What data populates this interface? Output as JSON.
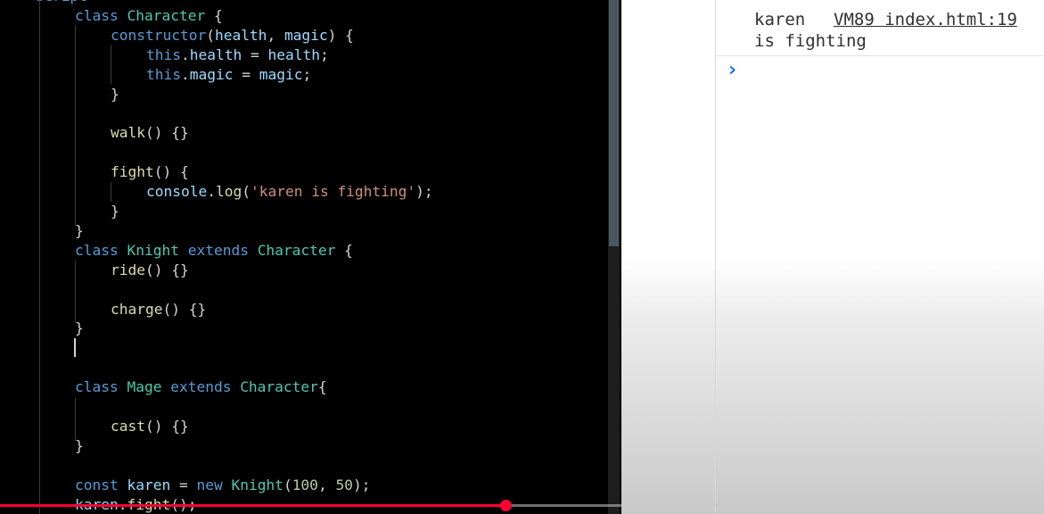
{
  "editor": {
    "partial_top_line": "script",
    "lines": [
      {
        "tokens": [
          {
            "t": "class ",
            "c": "kw"
          },
          {
            "t": "Character",
            "c": "cls"
          },
          {
            "t": " {",
            "c": "def"
          }
        ]
      },
      {
        "tokens": [
          {
            "t": "constructor",
            "c": "kw"
          },
          {
            "t": "(",
            "c": "def"
          },
          {
            "t": "health",
            "c": "par"
          },
          {
            "t": ", ",
            "c": "def"
          },
          {
            "t": "magic",
            "c": "par"
          },
          {
            "t": ") {",
            "c": "def"
          }
        ]
      },
      {
        "tokens": [
          {
            "t": "this",
            "c": "kw"
          },
          {
            "t": ".",
            "c": "def"
          },
          {
            "t": "health",
            "c": "par"
          },
          {
            "t": " = ",
            "c": "def"
          },
          {
            "t": "health",
            "c": "par"
          },
          {
            "t": ";",
            "c": "def"
          }
        ]
      },
      {
        "tokens": [
          {
            "t": "this",
            "c": "kw"
          },
          {
            "t": ".",
            "c": "def"
          },
          {
            "t": "magic",
            "c": "par"
          },
          {
            "t": " = ",
            "c": "def"
          },
          {
            "t": "magic",
            "c": "par"
          },
          {
            "t": ";",
            "c": "def"
          }
        ]
      },
      {
        "tokens": [
          {
            "t": "}",
            "c": "def"
          }
        ]
      },
      {
        "tokens": []
      },
      {
        "tokens": [
          {
            "t": "walk",
            "c": "fn"
          },
          {
            "t": "() {}",
            "c": "def"
          }
        ]
      },
      {
        "tokens": []
      },
      {
        "tokens": [
          {
            "t": "fight",
            "c": "fn"
          },
          {
            "t": "() {",
            "c": "def"
          }
        ]
      },
      {
        "tokens": [
          {
            "t": "console",
            "c": "par"
          },
          {
            "t": ".",
            "c": "def"
          },
          {
            "t": "log",
            "c": "fn"
          },
          {
            "t": "(",
            "c": "def"
          },
          {
            "t": "'karen is fighting'",
            "c": "str"
          },
          {
            "t": ");",
            "c": "def"
          }
        ]
      },
      {
        "tokens": [
          {
            "t": "}",
            "c": "def"
          }
        ]
      },
      {
        "tokens": [
          {
            "t": "}",
            "c": "def"
          }
        ]
      },
      {
        "tokens": [
          {
            "t": "class ",
            "c": "kw"
          },
          {
            "t": "Knight",
            "c": "cls"
          },
          {
            "t": " extends ",
            "c": "kw"
          },
          {
            "t": "Character",
            "c": "cls"
          },
          {
            "t": " {",
            "c": "def"
          }
        ]
      },
      {
        "tokens": [
          {
            "t": "ride",
            "c": "fn"
          },
          {
            "t": "() {}",
            "c": "def"
          }
        ]
      },
      {
        "tokens": []
      },
      {
        "tokens": [
          {
            "t": "charge",
            "c": "fn"
          },
          {
            "t": "() {}",
            "c": "def"
          }
        ]
      },
      {
        "tokens": [
          {
            "t": "}",
            "c": "def"
          }
        ]
      },
      {
        "tokens": []
      },
      {
        "tokens": []
      },
      {
        "tokens": [
          {
            "t": "class ",
            "c": "kw"
          },
          {
            "t": "Mage",
            "c": "cls"
          },
          {
            "t": " extends ",
            "c": "kw"
          },
          {
            "t": "Character",
            "c": "cls"
          },
          {
            "t": "{",
            "c": "def"
          }
        ]
      },
      {
        "tokens": []
      },
      {
        "tokens": [
          {
            "t": "cast",
            "c": "fn"
          },
          {
            "t": "() {}",
            "c": "def"
          }
        ]
      },
      {
        "tokens": [
          {
            "t": "}",
            "c": "def"
          }
        ]
      },
      {
        "tokens": []
      },
      {
        "tokens": [
          {
            "t": "const ",
            "c": "kw"
          },
          {
            "t": "karen",
            "c": "par"
          },
          {
            "t": " = ",
            "c": "def"
          },
          {
            "t": "new ",
            "c": "kw"
          },
          {
            "t": "Knight",
            "c": "cls"
          },
          {
            "t": "(",
            "c": "def"
          },
          {
            "t": "100",
            "c": "num"
          },
          {
            "t": ", ",
            "c": "def"
          },
          {
            "t": "50",
            "c": "num"
          },
          {
            "t": ");",
            "c": "def"
          }
        ]
      },
      {
        "tokens": [
          {
            "t": "karen",
            "c": "par"
          },
          {
            "t": ".",
            "c": "def"
          },
          {
            "t": "fight",
            "c": "fn"
          },
          {
            "t": "();",
            "c": "def"
          }
        ]
      }
    ]
  },
  "console": {
    "log_text_line1": "karen",
    "log_text_line2": "is fighting",
    "log_source": "VM89 index.html:19",
    "prompt_symbol": "›"
  },
  "video": {
    "progress_fraction": 0.484
  },
  "colors": {
    "keyword": "#569cd6",
    "class_name": "#4ec9b0",
    "variable": "#9cdcfe",
    "string": "#ce9178",
    "number": "#b5cea8",
    "function": "#dcdcaa",
    "progress": "#ff0033",
    "console_prompt": "#1a73e8"
  }
}
